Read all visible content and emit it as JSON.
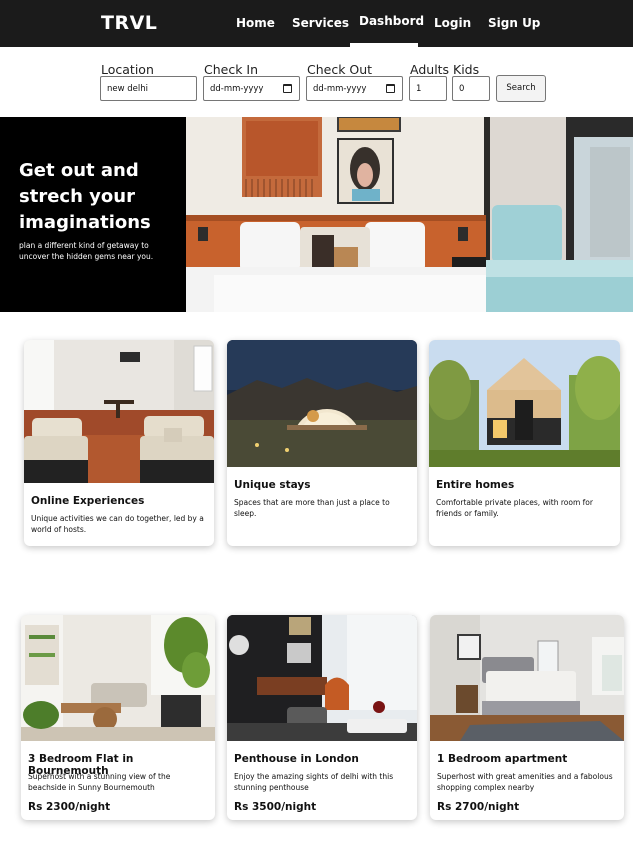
{
  "nav": {
    "brand": "TRVL",
    "links": [
      "Home",
      "Services",
      "Dashbord",
      "Login",
      "Sign Up"
    ]
  },
  "search": {
    "location_label": "Location",
    "location_value": "new delhi",
    "checkin_label": "Check In",
    "checkin_value": "dd-mm-yyyy",
    "checkout_label": "Check Out",
    "checkout_value": "dd-mm-yyyy",
    "adults_label": "Adults",
    "adults_value": "1",
    "kids_label": "Kids",
    "kids_value": "0",
    "button": "Search"
  },
  "hero": {
    "title": "Get out and strech your imaginations",
    "subtitle": "plan a different kind of getaway to uncover the hidden gems near you."
  },
  "categories": [
    {
      "title": "Online Experiences",
      "desc": "Unique activities we can do together, led by a world of hosts."
    },
    {
      "title": "Unique stays",
      "desc": "Spaces that are more than just a place to sleep."
    },
    {
      "title": "Entire homes",
      "desc": "Comfortable private places, with room for friends or family."
    }
  ],
  "listings": [
    {
      "title": "3 Bedroom Flat in Bournemouth",
      "desc": "Superhost with a stunning view of the beachside in Sunny Bournemouth",
      "price": "Rs 2300/night"
    },
    {
      "title": "Penthouse in London",
      "desc": "Enjoy the amazing sights of delhi with this stunning penthouse",
      "price": "Rs 3500/night"
    },
    {
      "title": "1 Bedroom apartment",
      "desc": "Superhost with great amenities and a fabolous shopping complex nearby",
      "price": "Rs 2700/night"
    }
  ],
  "colors": {
    "nav_bg": "#1b1b1b",
    "hero_panel": "#000000"
  }
}
